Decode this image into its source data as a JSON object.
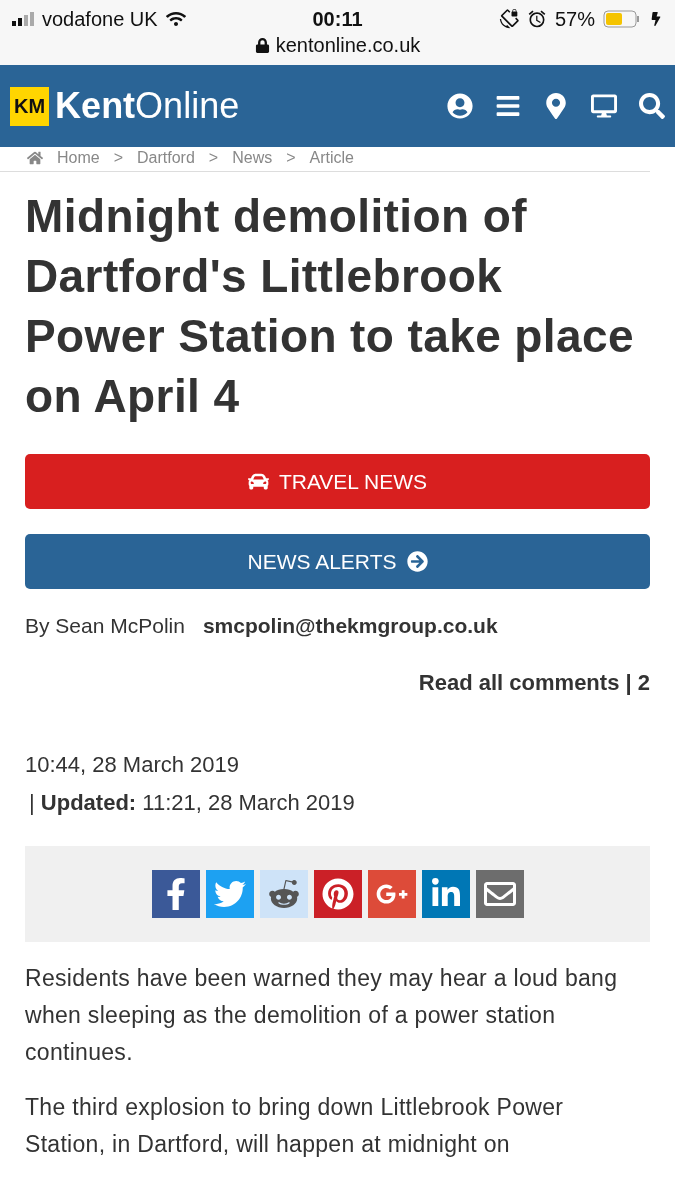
{
  "status_bar": {
    "carrier": "vodafone UK",
    "time": "00:11",
    "battery": "57%",
    "url": "kentonline.co.uk"
  },
  "header": {
    "logo_badge": "KM",
    "logo_bold": "Kent",
    "logo_light": "Online"
  },
  "breadcrumb": [
    "Home",
    "Dartford",
    "News",
    "Article"
  ],
  "breadcrumb_separator": ">",
  "title": "Midnight demolition of Dartford's Littlebrook Power Station to take place on April 4",
  "buttons": [
    {
      "kind": "travel",
      "label": "TRAVEL NEWS"
    },
    {
      "kind": "alerts",
      "label": "NEWS ALERTS"
    }
  ],
  "byline": {
    "author": "By Sean McPolin",
    "email": "smcpolin@thekmgroup.co.uk"
  },
  "comments": "Read all comments | 2",
  "published": "10:44, 28 March 2019",
  "updated": {
    "separator": "|",
    "label": "Updated:",
    "time": "11:21, 28 March 2019"
  },
  "share": [
    {
      "kind": "facebook"
    },
    {
      "kind": "twitter"
    },
    {
      "kind": "reddit"
    },
    {
      "kind": "pinterest"
    },
    {
      "kind": "googleplus"
    },
    {
      "kind": "linkedin"
    },
    {
      "kind": "email"
    }
  ],
  "paragraphs": [
    "Residents have been warned they may hear a loud bang when sleeping as the demolition of a power station continues.",
    "The third explosion to bring down Littlebrook Power Station, in Dartford, will happen at midnight on"
  ]
}
